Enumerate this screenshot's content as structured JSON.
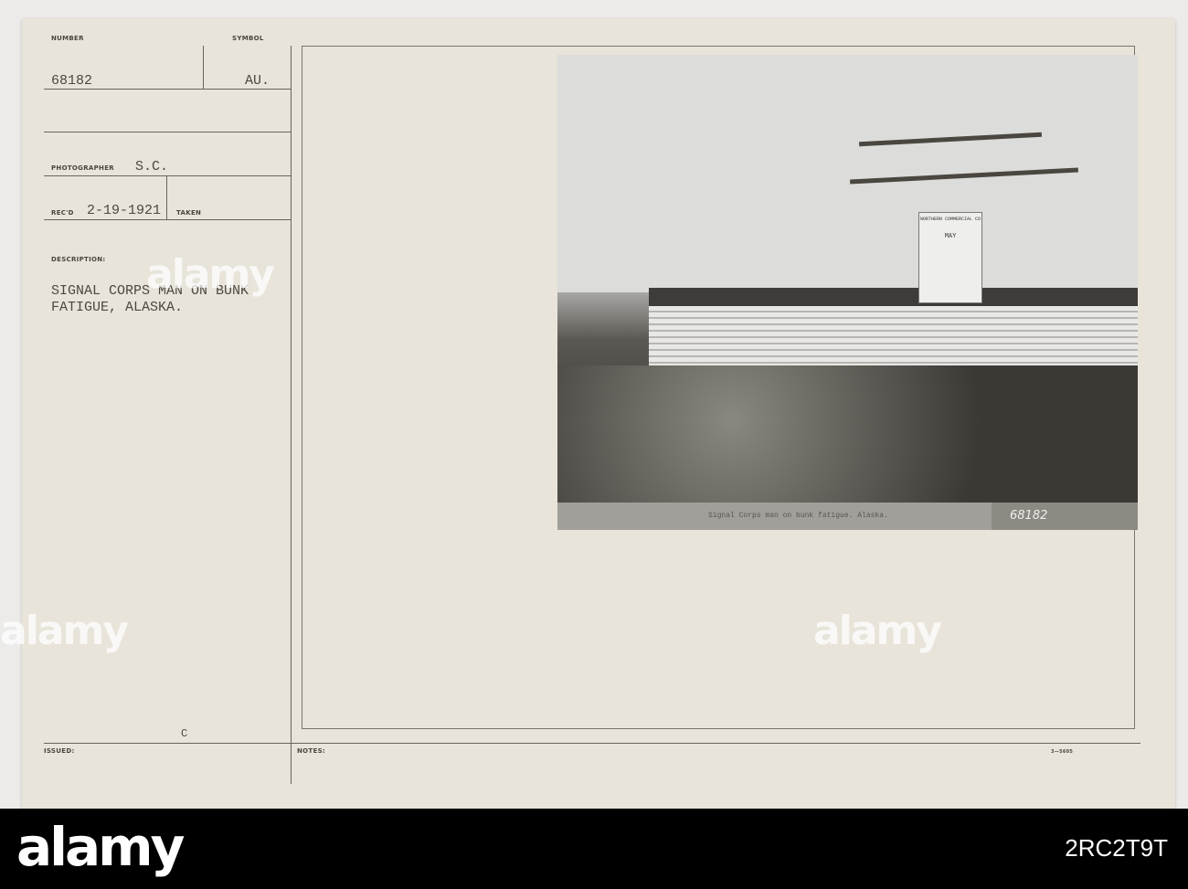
{
  "card": {
    "number_label": "NUMBER",
    "number": "68182",
    "symbol_label": "SYMBOL",
    "symbol": "AU.",
    "photographer_label": "PHOTOGRAPHER",
    "photographer": "S.C.",
    "recd_label": "REC'D",
    "recd": "2-19-1921",
    "taken_label": "TAKEN",
    "description_label": "DESCRIPTION:",
    "description_line1": "SIGNAL CORPS MAN ON BUNK",
    "description_line2": "FATIGUE, ALASKA.",
    "issued_label": "ISSUED:",
    "issued_value": "C",
    "notes_label": "NOTES:",
    "form_number": "3—5605"
  },
  "photo": {
    "caption": "Signal Corps man on bunk fatigue.  Alaska.",
    "photo_number": "68182",
    "calendar_header": "NORTHERN COMMERCIAL CO",
    "calendar_month": "MAY"
  },
  "watermark": "alamy",
  "footer": {
    "logo": "alamy",
    "image_id": "2RC2T9T"
  }
}
